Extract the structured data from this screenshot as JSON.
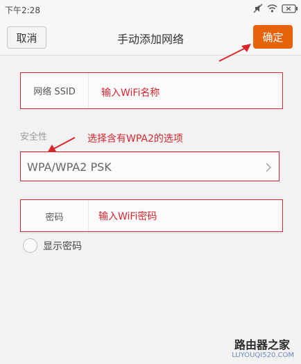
{
  "status_bar": {
    "time": "下午2:28",
    "icons": [
      "mute-icon",
      "wifi-icon",
      "battery-icon"
    ]
  },
  "header": {
    "cancel_label": "取消",
    "title": "手动添加网络",
    "confirm_label": "确定",
    "confirm_color": "#e8620a"
  },
  "ssid_field": {
    "label": "网络 SSID",
    "value": "",
    "hint": "输入WiFi名称"
  },
  "security": {
    "label": "安全性",
    "value": "WPA/WPA2 PSK",
    "hint": "选择含有WPA2的选项"
  },
  "password_field": {
    "label": "密码",
    "value": "",
    "hint": "输入WiFi密码"
  },
  "show_password": {
    "label": "显示密码",
    "checked": false
  },
  "watermark": {
    "brand": "路由器之家",
    "domain": "LUYOUQI520.COM"
  },
  "annotation_color": "#d9262d"
}
